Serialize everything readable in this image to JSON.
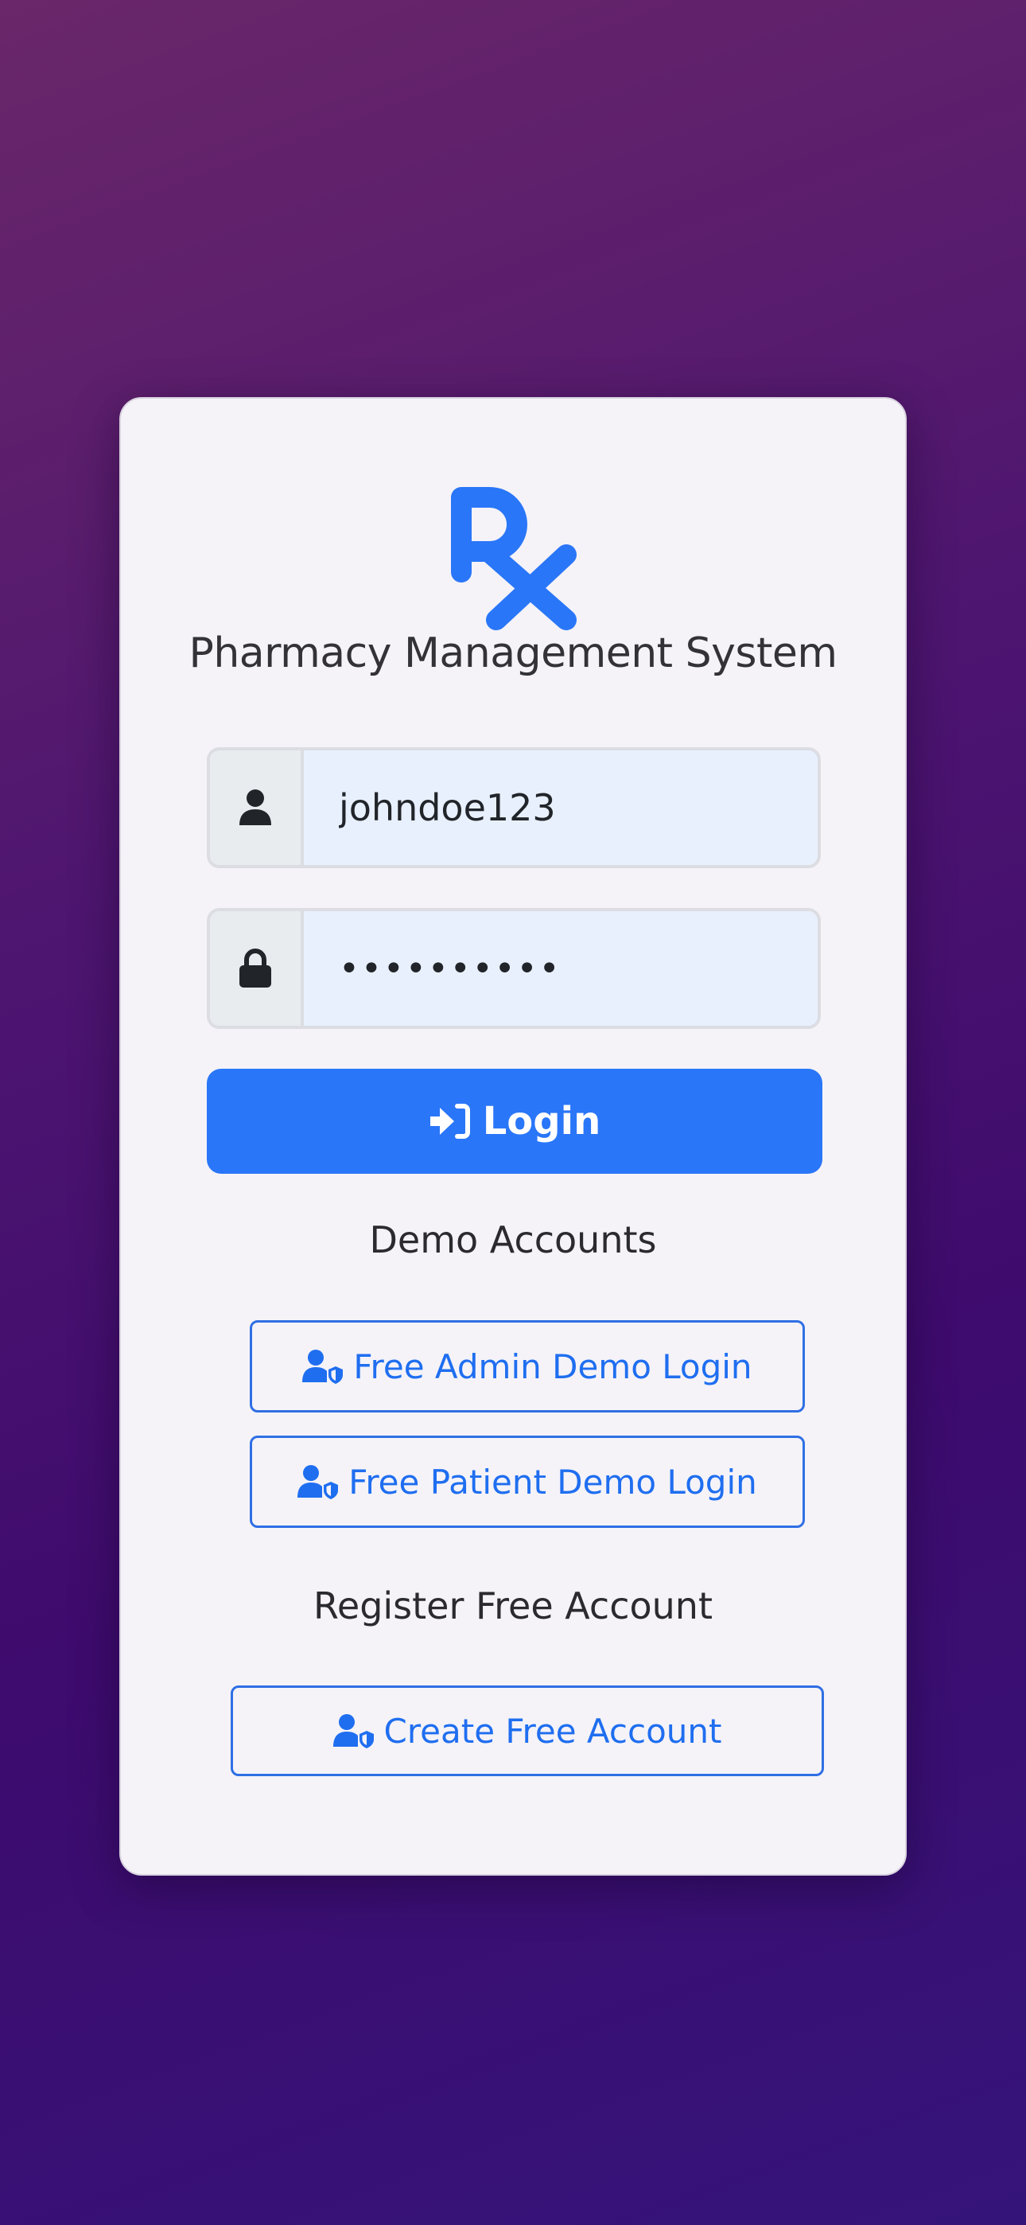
{
  "app": {
    "title": "Pharmacy Management System",
    "logo_icon": "rx-icon",
    "brand_color": "#2a76f8"
  },
  "login_form": {
    "username": {
      "icon": "user-icon",
      "value": "johndoe123"
    },
    "password": {
      "icon": "lock-icon",
      "value": "••••••••••"
    },
    "submit": {
      "icon": "sign-in-icon",
      "label": "Login"
    }
  },
  "demo": {
    "heading": "Demo Accounts",
    "admin_button": {
      "icon": "user-shield-icon",
      "label": "Free Admin Demo Login"
    },
    "patient_button": {
      "icon": "user-shield-icon",
      "label": "Free Patient Demo Login"
    }
  },
  "register": {
    "heading": "Register Free Account",
    "create_button": {
      "icon": "user-shield-icon",
      "label": "Create Free Account"
    }
  }
}
